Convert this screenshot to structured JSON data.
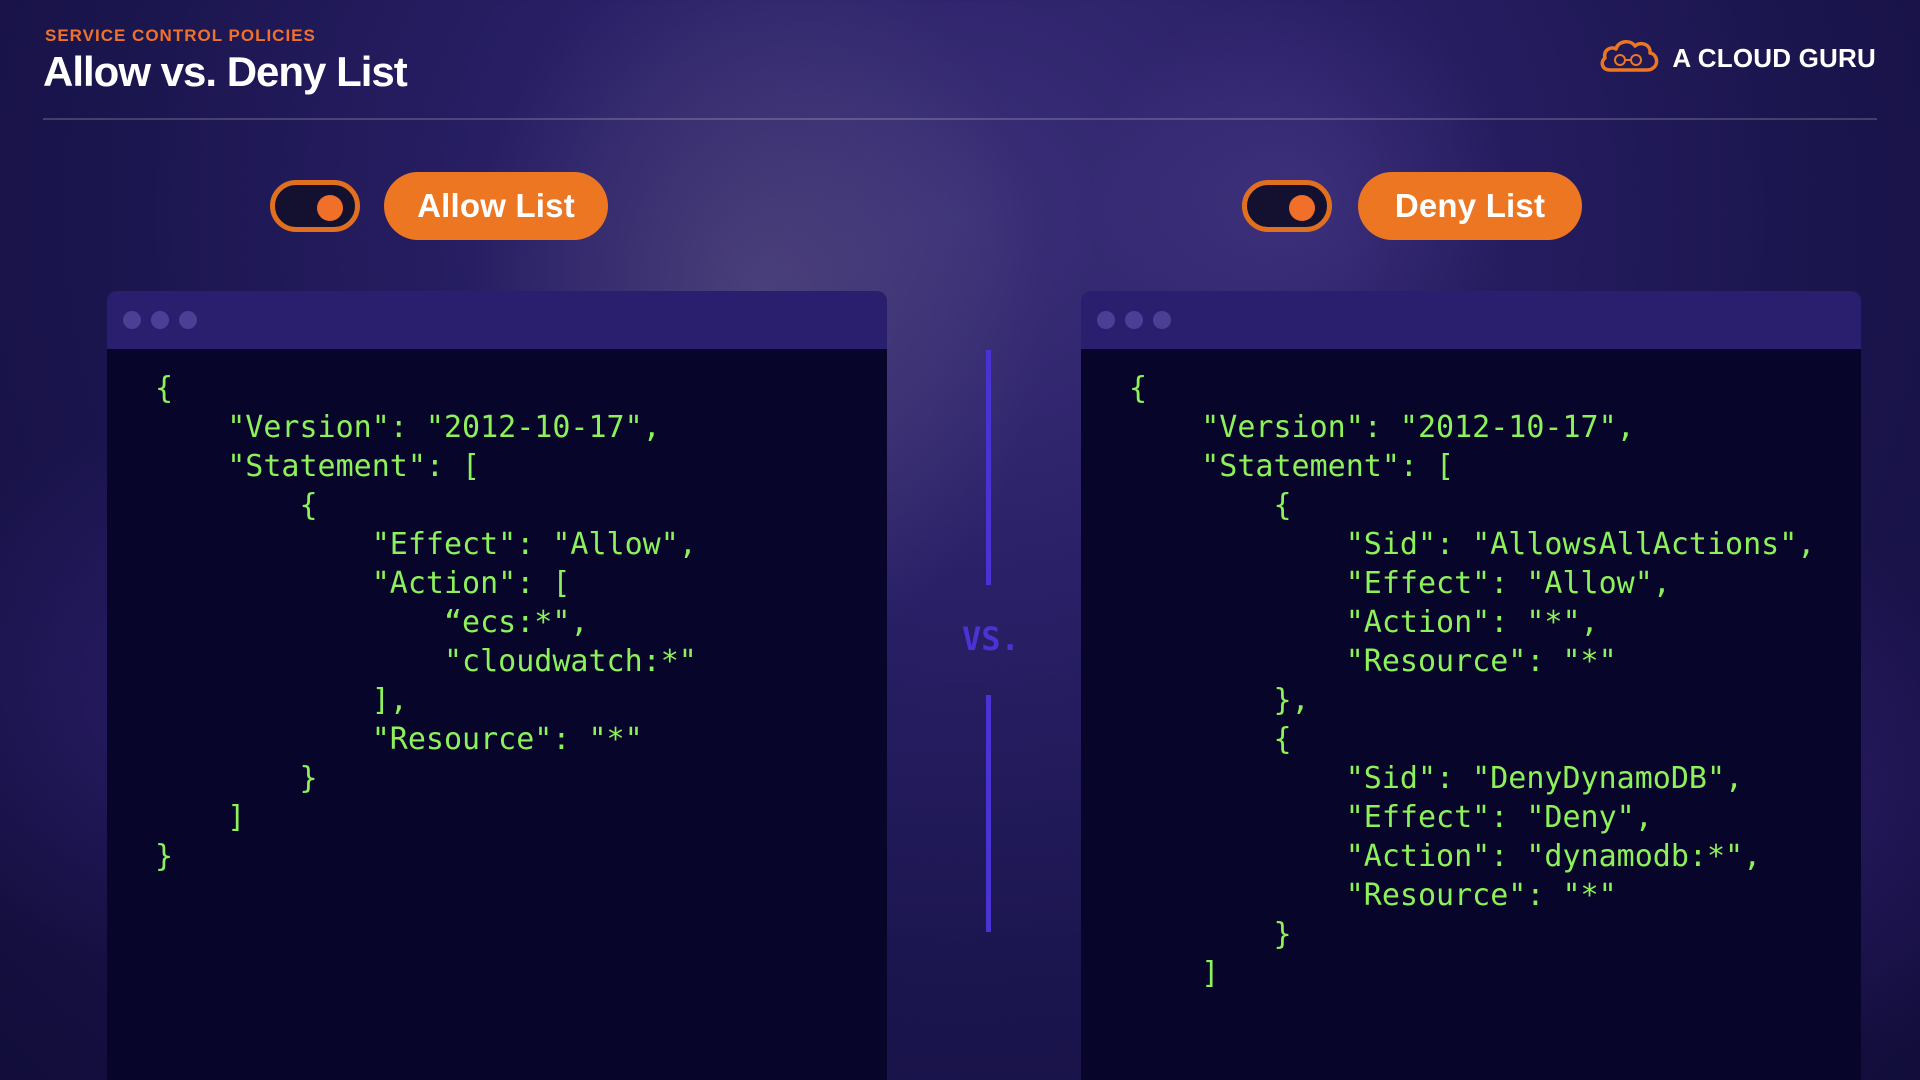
{
  "header": {
    "eyebrow": "SERVICE CONTROL POLICIES",
    "title": "Allow vs. Deny List",
    "brand": "A CLOUD GURU"
  },
  "colors": {
    "accent": "#ec7622",
    "code": "#8cf25a",
    "divider": "#4a33d4",
    "window_bar": "#2a1f6e",
    "window_body": "#07052a"
  },
  "left_panel": {
    "toggle_state": "on",
    "label": "Allow List",
    "code": "{\n    \"Version\": \"2012-10-17\",\n    \"Statement\": [\n        {\n            \"Effect\": \"Allow\",\n            \"Action\": [\n                “ecs:*\",\n                \"cloudwatch:*\"\n            ],\n            \"Resource\": \"*\"\n        }\n    ]\n}"
  },
  "divider": {
    "label": "VS."
  },
  "right_panel": {
    "toggle_state": "on",
    "label": "Deny List",
    "code": "{\n    \"Version\": \"2012-10-17\",\n    \"Statement\": [\n        {\n            \"Sid\": \"AllowsAllActions\",\n            \"Effect\": \"Allow\",\n            \"Action\": \"*\",\n            \"Resource\": \"*\"\n        },\n        {\n            \"Sid\": \"DenyDynamoDB\",\n            \"Effect\": \"Deny\",\n            \"Action\": \"dynamodb:*\",\n            \"Resource\": \"*\"\n        }\n    ]"
  },
  "icons": {
    "brand_logo": "cloud-icon",
    "window_controls": "window-dot-icon"
  }
}
